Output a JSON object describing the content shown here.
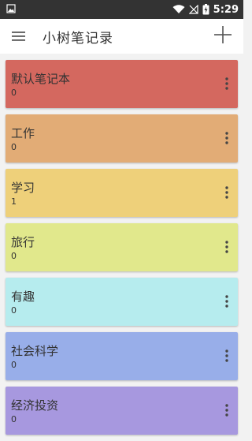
{
  "status_bar": {
    "time": "5:29",
    "icons": [
      "image-notification-icon",
      "wifi-icon",
      "no-sim-icon",
      "battery-charging-icon"
    ]
  },
  "app_bar": {
    "title": "小树笔记录",
    "menu_icon": "hamburger-menu-icon",
    "add_icon": "plus-icon"
  },
  "notebooks": [
    {
      "name": "默认笔记本",
      "count": "0",
      "color": "#d4685f"
    },
    {
      "name": "工作",
      "count": "0",
      "color": "#e2ac76"
    },
    {
      "name": "学习",
      "count": "1",
      "color": "#eed07a"
    },
    {
      "name": "旅行",
      "count": "0",
      "color": "#e1e88c"
    },
    {
      "name": "有趣",
      "count": "0",
      "color": "#b6ecee"
    },
    {
      "name": "社会科学",
      "count": "0",
      "color": "#98aee9"
    },
    {
      "name": "经济投资",
      "count": "0",
      "color": "#a798df"
    }
  ]
}
